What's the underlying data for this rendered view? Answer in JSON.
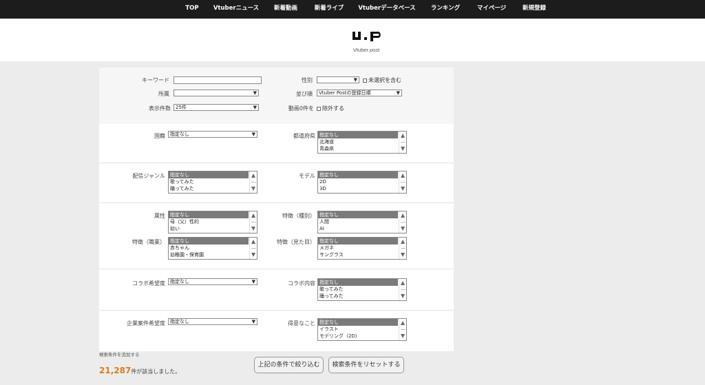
{
  "nav": {
    "items": [
      "TOP",
      "Vtuberニュース",
      "新着動画",
      "新着ライブ",
      "Vtuberデータベース",
      "ランキング",
      "マイページ",
      "新規登録"
    ],
    "active": "Vtuberニュース"
  },
  "logo": {
    "mark": "V.P",
    "subtitle": "Vtuber post"
  },
  "search": {
    "keyword": {
      "label": "キーワード",
      "value": ""
    },
    "gender": {
      "label": "性別",
      "value": "",
      "checkbox_label": "未選択を含む"
    },
    "affiliation": {
      "label": "所属",
      "value": ""
    },
    "sort": {
      "label": "並び順",
      "value": "Vtuber Postの登録日順"
    },
    "per_page": {
      "label": "表示件数",
      "value": "25件"
    },
    "videos_zero": {
      "label": "動画0件を",
      "checkbox_label": "除外する"
    },
    "country": {
      "label": "国籍",
      "value": "指定なし"
    },
    "prefecture": {
      "label": "都道府県",
      "options": [
        "指定なし",
        "北海道",
        "青森県"
      ]
    },
    "genre": {
      "label": "配信ジャンル",
      "options": [
        "指定なし",
        "歌ってみた",
        "踊ってみた"
      ]
    },
    "model": {
      "label": "モデル",
      "options": [
        "指定なし",
        "2D",
        "3D"
      ]
    },
    "attribute": {
      "label": "属性",
      "options": [
        "指定なし",
        "母（父）性的",
        "幼い"
      ]
    },
    "feature_species": {
      "label": "特徴（種別）",
      "options": [
        "指定なし",
        "人間",
        "AI"
      ]
    },
    "feature_job": {
      "label": "特徴（職業）",
      "options": [
        "指定なし",
        "赤ちゃん",
        "幼稚園・保育園"
      ]
    },
    "feature_look": {
      "label": "特徴（見た目）",
      "options": [
        "指定なし",
        "メガネ",
        "サングラス"
      ]
    },
    "collab_wish": {
      "label": "コラボ希望度",
      "value": "指定なし"
    },
    "collab_content": {
      "label": "コラボ内容",
      "options": [
        "指定なし",
        "歌ってみた",
        "踊ってみた"
      ]
    },
    "corporate_wish": {
      "label": "企業案件希望度",
      "value": "指定なし"
    },
    "specialty": {
      "label": "得意なこと",
      "options": [
        "指定なし",
        "イラスト",
        "モデリング（2D）"
      ]
    }
  },
  "footer": {
    "add_condition": "検索条件を追加する",
    "result_count": "21,287",
    "result_suffix": "件が該当しました。",
    "filter_button": "上記の条件で絞り込む",
    "reset_button": "検索条件をリセットする"
  }
}
